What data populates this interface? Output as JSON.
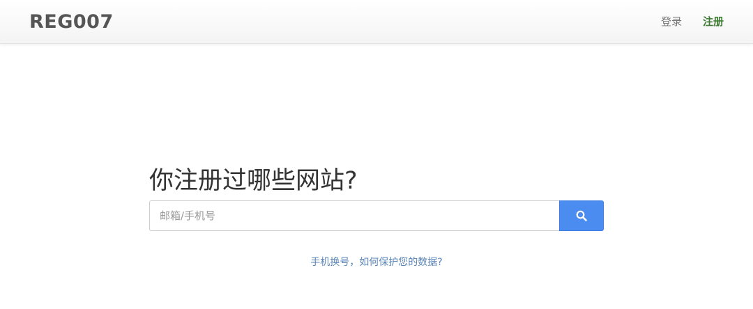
{
  "navbar": {
    "brand": "REG007",
    "links": [
      {
        "label": "登录",
        "active": false
      },
      {
        "label": "注册",
        "active": true
      }
    ]
  },
  "hero": {
    "title": "你注册过哪些网站?",
    "search": {
      "placeholder": "邮箱/手机号",
      "value": "",
      "button_icon": "search-icon"
    },
    "help_link": "手机换号，如何保护您的数据?"
  },
  "colors": {
    "accent": "#4a8cf0",
    "active_nav": "#3d7a32",
    "link": "#5a86b8"
  }
}
